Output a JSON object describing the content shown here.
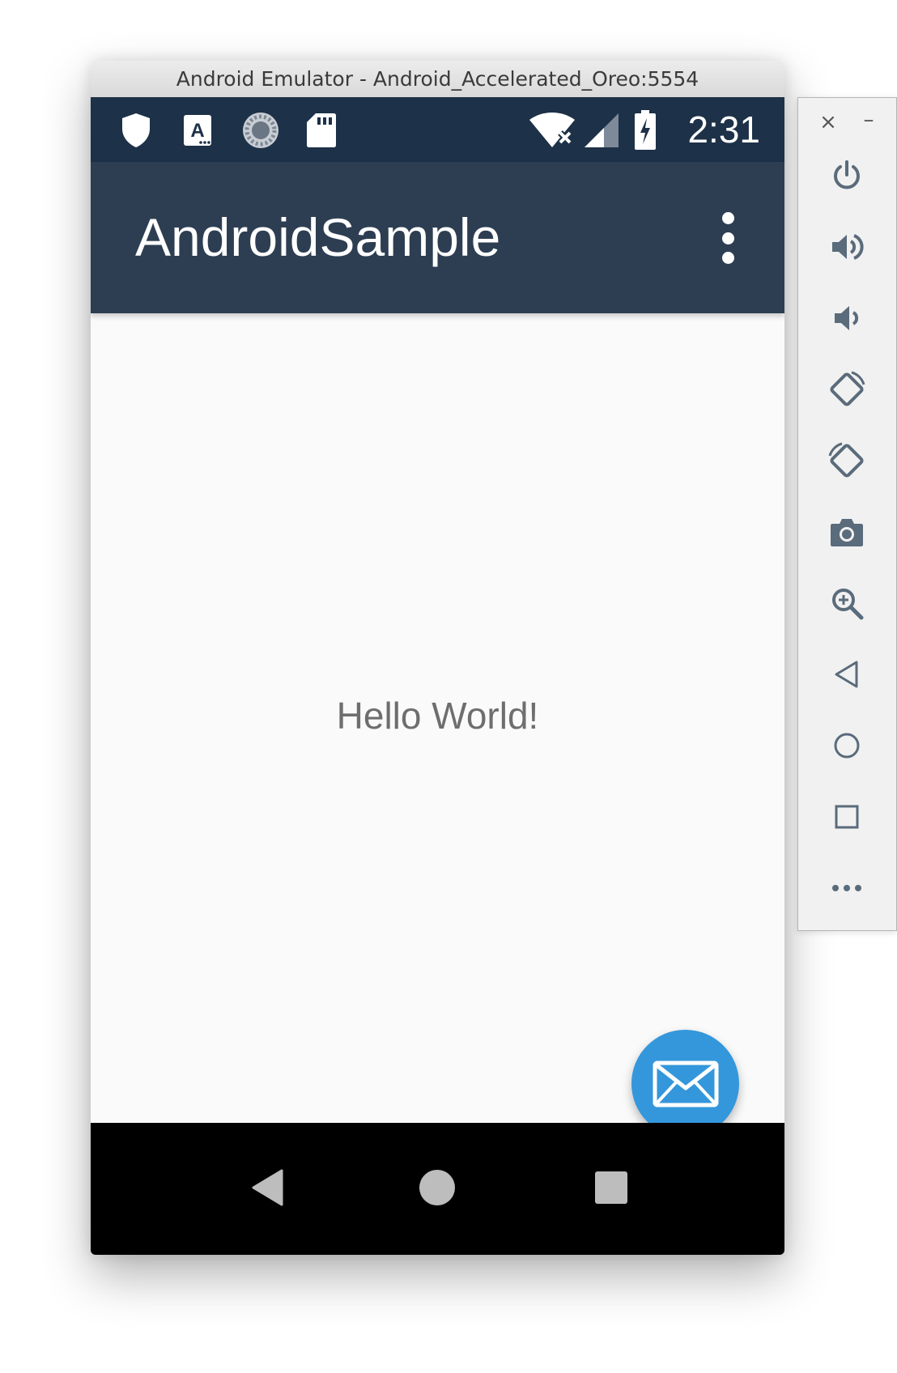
{
  "window": {
    "title": "Android Emulator - Android_Accelerated_Oreo:5554"
  },
  "status_bar": {
    "time": "2:31",
    "icons": [
      "shield-icon",
      "keyboard-a-icon",
      "sync-spinner-icon",
      "sd-card-icon",
      "wifi-off-icon",
      "cell-signal-icon",
      "battery-charging-icon"
    ]
  },
  "app_bar": {
    "title": "AndroidSample",
    "menu_icon": "more-vert-icon"
  },
  "content": {
    "text": "Hello World!"
  },
  "fab": {
    "icon": "mail-icon",
    "color": "#3497db"
  },
  "nav_bar": {
    "buttons": [
      "back-icon",
      "home-icon",
      "recents-icon"
    ]
  },
  "toolbar": {
    "close_label": "×",
    "minimize_label": "–",
    "buttons": [
      "power-icon",
      "volume-up-icon",
      "volume-down-icon",
      "rotate-left-icon",
      "rotate-right-icon",
      "camera-icon",
      "zoom-icon",
      "back-outline-icon",
      "home-outline-icon",
      "overview-outline-icon",
      "more-horiz-icon"
    ]
  },
  "colors": {
    "status_bar": "#1d3148",
    "app_bar": "#2d3e52",
    "accent": "#3497db"
  }
}
